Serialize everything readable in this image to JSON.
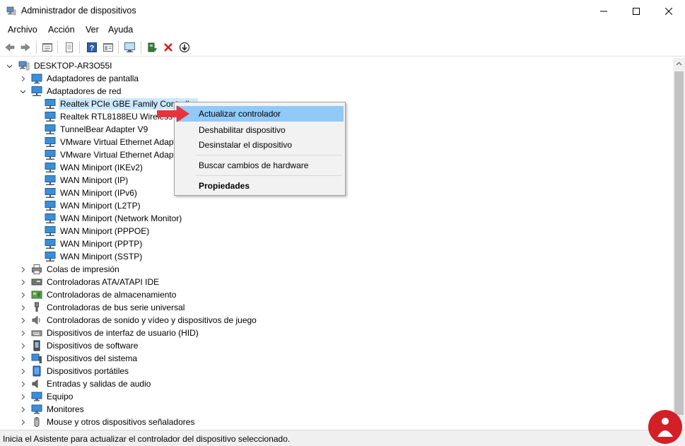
{
  "window": {
    "title": "Administrador de dispositivos",
    "controls": [
      "minimize-icon",
      "maximize-icon",
      "close-icon"
    ]
  },
  "menubar": {
    "items": [
      "Archivo",
      "Acción",
      "Ver",
      "Ayuda"
    ]
  },
  "toolbar": {
    "buttons": [
      "back-icon",
      "forward-icon",
      "properties-list-icon",
      "document-icon",
      "help-icon",
      "view-pane-icon",
      "monitor-scan-icon",
      "update-driver-icon",
      "uninstall-icon",
      "disable-icon"
    ]
  },
  "tree": {
    "root": "DESKTOP-AR3O55I",
    "categories_top": [
      "Adaptadores de pantalla",
      "Adaptadores de red"
    ],
    "network_adapters": [
      "Realtek PCIe GBE Family Controller",
      "Realtek RTL8188EU Wireless LA",
      "TunnelBear Adapter V9",
      "VMware Virtual Ethernet Adapt",
      "VMware Virtual Ethernet Adapt",
      "WAN Miniport (IKEv2)",
      "WAN Miniport (IP)",
      "WAN Miniport (IPv6)",
      "WAN Miniport (L2TP)",
      "WAN Miniport (Network Monitor)",
      "WAN Miniport (PPPOE)",
      "WAN Miniport (PPTP)",
      "WAN Miniport (SSTP)"
    ],
    "categories_rest": [
      "Colas de impresión",
      "Controladoras ATA/ATAPI IDE",
      "Controladoras de almacenamiento",
      "Controladoras de bus serie universal",
      "Controladoras de sonido y vídeo y dispositivos de juego",
      "Dispositivos de interfaz de usuario (HID)",
      "Dispositivos de software",
      "Dispositivos del sistema",
      "Dispositivos portátiles",
      "Entradas y salidas de audio",
      "Equipo",
      "Monitores",
      "Mouse y otros dispositivos señaladores"
    ]
  },
  "context_menu": {
    "update": "Actualizar controlador",
    "disable": "Deshabilitar dispositivo",
    "uninstall": "Desinstalar el dispositivo",
    "scan": "Buscar cambios de hardware",
    "properties": "Propiedades"
  },
  "status": {
    "text": "Inicia el Asistente para actualizar el controlador del dispositivo seleccionado."
  },
  "colors": {
    "selection": "#cce8ff",
    "menu_hover": "#91c9f7",
    "arrow": "#e8333b"
  }
}
